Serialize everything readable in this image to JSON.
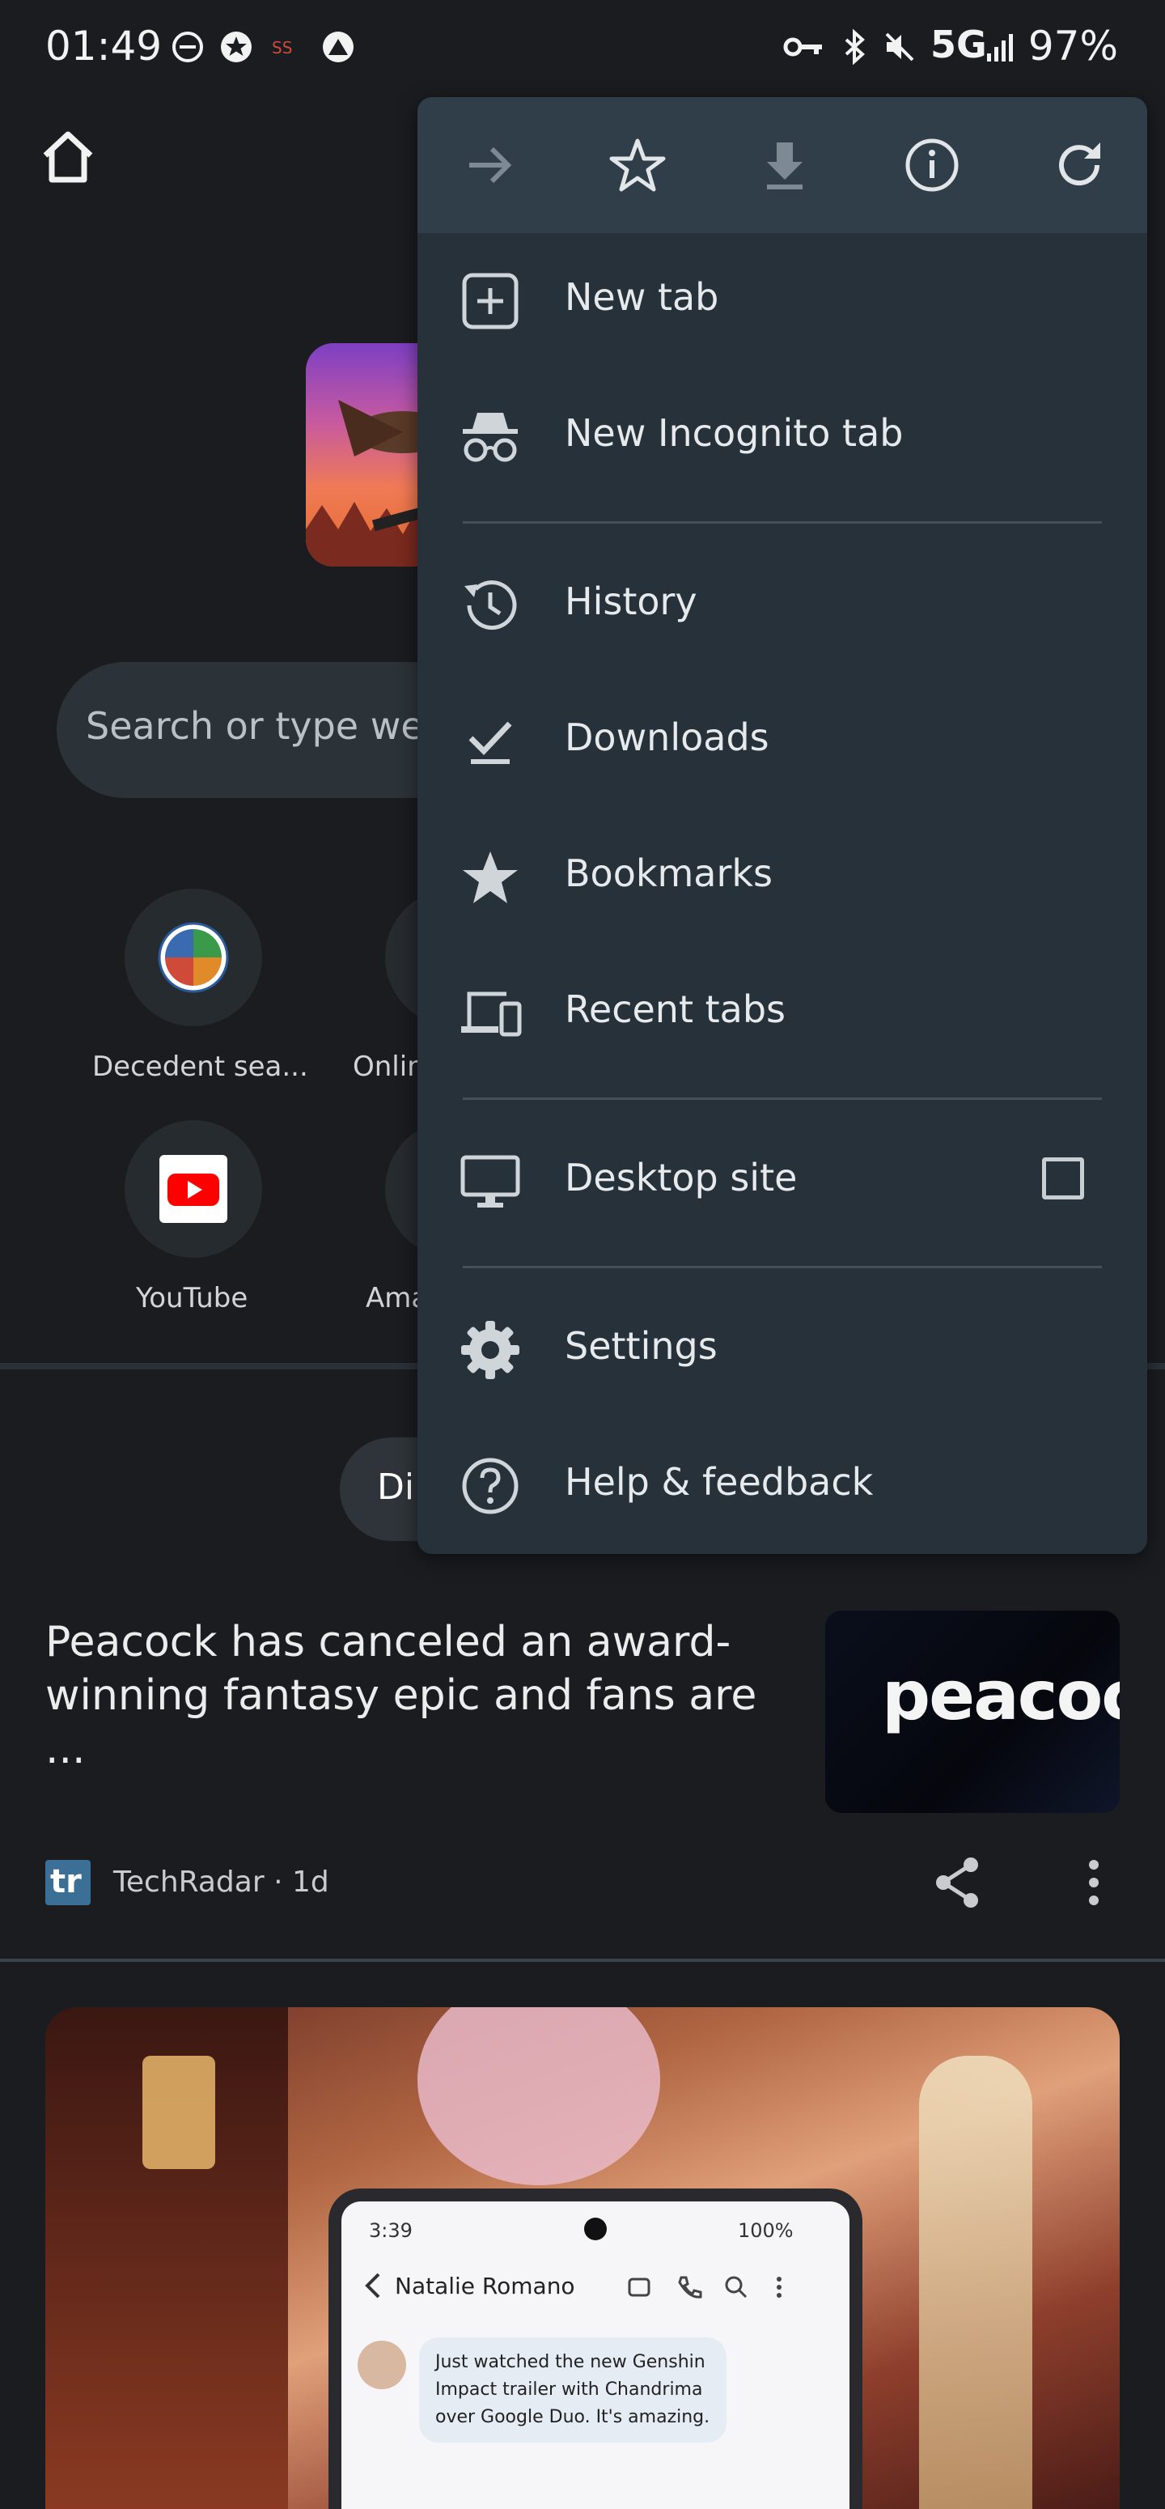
{
  "status_bar": {
    "time": "01:49",
    "network": "5G",
    "battery": "97%"
  },
  "search": {
    "placeholder_visible": "Search or type web"
  },
  "shortcuts": [
    {
      "label": "Decedent sea..."
    },
    {
      "label": "Onlin"
    },
    {
      "label": "YouTube"
    },
    {
      "label": "Ama"
    }
  ],
  "discover_pill": {
    "label": "Di"
  },
  "article": {
    "headline": "Peacock has canceled an award-winning fantasy epic and fans are ...",
    "image_text": "peacock",
    "source_logo": "tr",
    "source": "TechRadar · 1d"
  },
  "phone_mock": {
    "time": "3:39",
    "battery": "100%",
    "contact": "Natalie Romano",
    "message": "Just watched the new Genshin Impact trailer with Chandrima over Google Duo. It's amazing."
  },
  "menu": {
    "toolbar": [
      "forward-icon",
      "bookmark-star-icon",
      "download-icon",
      "info-icon",
      "reload-icon"
    ],
    "items": {
      "new_tab": "New tab",
      "new_incognito_tab": "New Incognito tab",
      "history": "History",
      "downloads": "Downloads",
      "bookmarks": "Bookmarks",
      "recent_tabs": "Recent tabs",
      "desktop_site": "Desktop site",
      "settings": "Settings",
      "help_feedback": "Help & feedback"
    },
    "desktop_site_checked": false
  },
  "colors": {
    "background": "#1b1c1f",
    "menu_bg": "#26313a",
    "menu_toolbar_bg": "#2f3e48",
    "youtube_red": "#ff0000"
  }
}
